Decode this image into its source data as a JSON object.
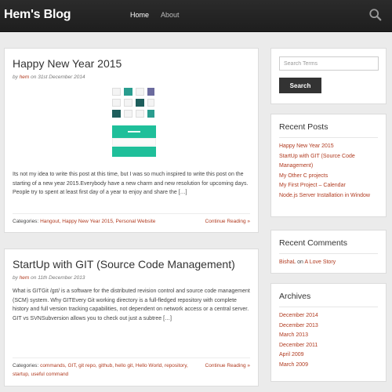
{
  "navbar": {
    "brand": "Hem's Blog",
    "items": [
      {
        "label": "Home"
      },
      {
        "label": "About"
      }
    ],
    "icon": "search-icon"
  },
  "posts": [
    {
      "title": "Happy New Year 2015",
      "meta_by": "by",
      "author": "hem",
      "meta_on": "on",
      "date": "31st December 2014",
      "excerpt": "Its not my idea to write this post at this time, but I was so much inspired to write this post on the starting of a new year 2015.Everybody have a new charm and new resolution for upcoming days. People try to spent at least first day of a year to enjoy and share the […]",
      "categories_label": "Categories:",
      "categories": "Hangout, Happy New Year 2015, Personal Website",
      "continue": "Continue Reading »"
    },
    {
      "title": "StartUp with GIT (Source Code Management)",
      "meta_by": "by",
      "author": "hem",
      "meta_on": "on",
      "date": "11th December 2013",
      "excerpt": "What is GITGit /gɪt/ is a software for the distributed revision control and source code management (SCM) system. Why GITEvery Git working directory is a full-fledged repository with complete history and full version tracking capabilities, not dependent on network access or a central server. GIT vs SVNSubversion allows you to check out just a subtree […]",
      "categories_label": "Categories:",
      "categories": "commands, GIT, git repo, github, hello git, Hello World, repository, startup, useful command",
      "continue": "Continue Reading »"
    }
  ],
  "sidebar": {
    "search": {
      "placeholder": "Search Terms",
      "button": "Search"
    },
    "recent_posts": {
      "title": "Recent Posts",
      "items": [
        "Happy New Year 2015",
        "StartUp with GIT (Source Code Management)",
        "My Other C projects",
        "My First Project – Calendar",
        "Node.js Server Installation in Window"
      ]
    },
    "recent_comments": {
      "title": "Recent Comments",
      "commenter": "BishaL",
      "on": "on",
      "post": "A Love Story"
    },
    "archives": {
      "title": "Archives",
      "items": [
        "December 2014",
        "December 2013",
        "March 2013",
        "December 2011",
        "April 2009",
        "March 2009"
      ]
    }
  },
  "colors": {
    "accent": "#b03a1f",
    "navbar": "#222222",
    "background": "#ebebeb"
  }
}
